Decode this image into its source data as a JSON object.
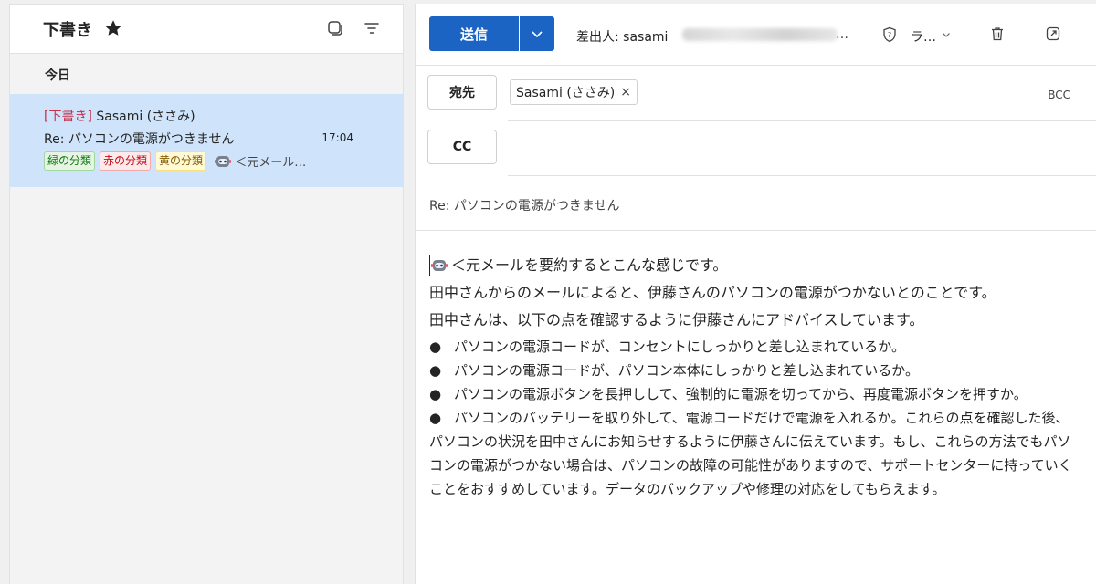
{
  "left": {
    "folder_title": "下書き",
    "group_label": "今日",
    "mail": {
      "draft_tag": "[下書き]",
      "sender": "Sasami (ささみ)",
      "subject": "Re: パソコンの電源がつきません",
      "time": "17:04",
      "categories": [
        "緑の分類",
        "赤の分類",
        "黄の分類"
      ],
      "preview": "＜元メール…"
    }
  },
  "compose": {
    "send_label": "送信",
    "from_label": "差出人: sasami",
    "from_ellipsis": "…",
    "sensitivity_label": "ラ…",
    "to_label": "宛先",
    "cc_label": "CC",
    "bcc_label": "BCC",
    "recipient": "Sasami (ささみ)",
    "recipient_remove": "×",
    "subject": "Re: パソコンの電源がつきません",
    "body": {
      "line1": "＜元メールを要約するとこんな感じです。",
      "line2": "田中さんからのメールによると、伊藤さんのパソコンの電源がつかないとのことです。",
      "line3": "田中さんは、以下の点を確認するように伊藤さんにアドバイスしています。",
      "bullets": [
        "パソコンの電源コードが、コンセントにしっかりと差し込まれているか。",
        "パソコンの電源コードが、パソコン本体にしっかりと差し込まれているか。",
        "パソコンの電源ボタンを長押しして、強制的に電源を切ってから、再度電源ボタンを押すか。",
        "パソコンのバッテリーを取り外して、電源コードだけで電源を入れるか。これらの点を確認した後、パソコンの状況を田中さんにお知らせするように伊藤さんに伝えています。もし、これらの方法でもパソコンの電源がつかない場合は、パソコンの故障の可能性がありますので、サポートセンターに持っていくことをおすすめしています。データのバックアップや修理の対応をしてもらえます。"
      ],
      "bullet_char": "●"
    }
  },
  "colors": {
    "accent": "#1b64c4",
    "selected": "#cfe4fa",
    "draft": "#c4314b"
  }
}
